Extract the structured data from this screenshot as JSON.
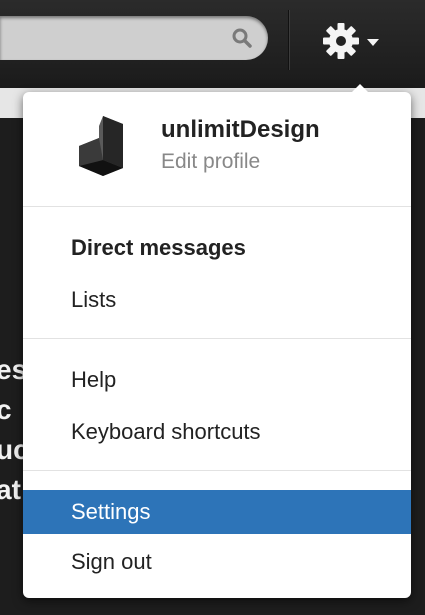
{
  "topbar": {
    "search_icon": "search-icon",
    "settings_icon": "gear-icon"
  },
  "menu": {
    "profile": {
      "username": "unlimitDesign",
      "subtitle": "Edit profile",
      "avatar_icon": "unlimitdesign-logo"
    },
    "items": [
      {
        "label": "Direct messages"
      },
      {
        "label": "Lists"
      },
      {
        "label": "Help"
      },
      {
        "label": "Keyboard shortcuts"
      },
      {
        "label": "Settings"
      },
      {
        "label": "Sign out"
      }
    ],
    "active_item": "Settings"
  },
  "background": {
    "partial_text_lines": [
      "es",
      "c",
      "uc",
      "at"
    ]
  },
  "colors": {
    "highlight": "#2d74b8",
    "topbar": "#1b1b1b",
    "menu_bg": "#ffffff"
  }
}
